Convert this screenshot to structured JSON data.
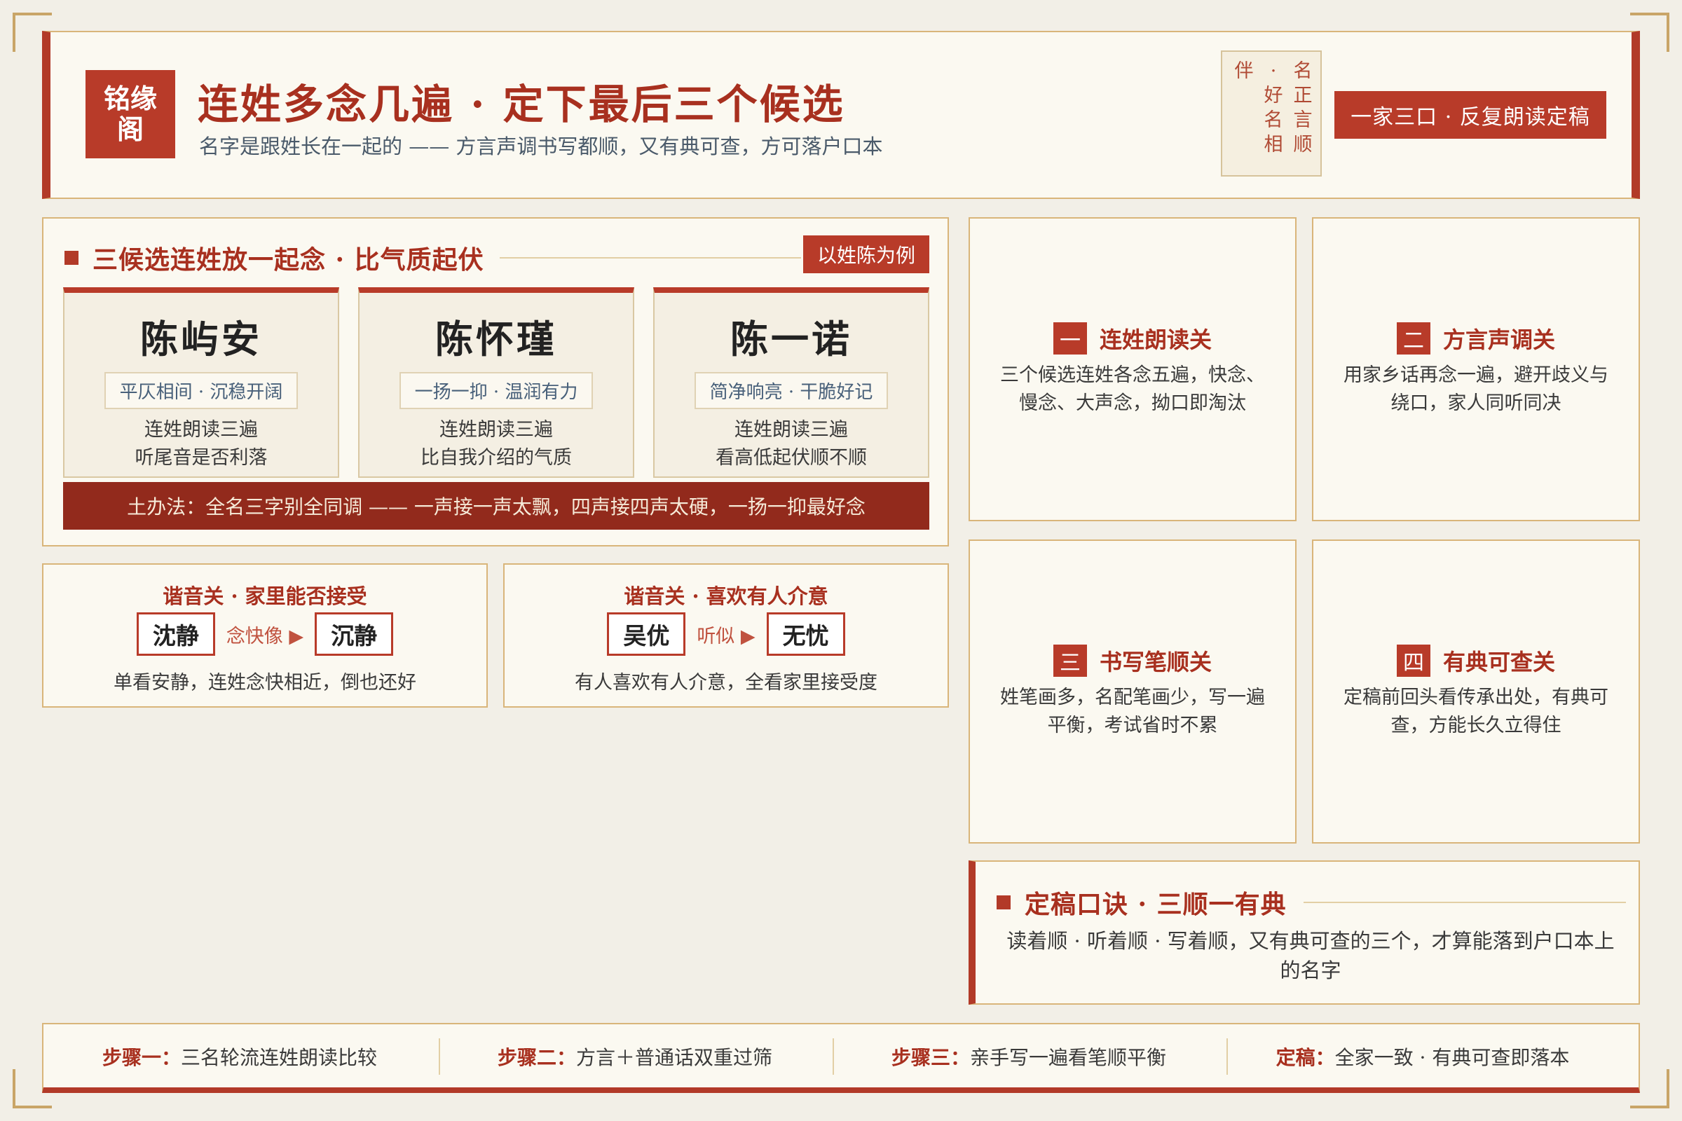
{
  "header": {
    "logo": "铭缘阁",
    "title": "连姓多念几遍 · 定下最后三个候选",
    "subtitle": "名字是跟姓长在一起的 —— 方言声调书写都顺，又有典可查，方可落户口本",
    "seal_cols": [
      "名正言顺",
      "·好名相",
      "伴"
    ],
    "tag": "一家三口 · 反复朗读定稿"
  },
  "candidates": {
    "title": "三候选连姓放一起念 · 比气质起伏",
    "tag": "以姓陈为例",
    "cards": [
      {
        "name": "陈屿安",
        "badge": "平仄相间 · 沉稳开阔",
        "line1": "连姓朗读三遍",
        "line2": "听尾音是否利落"
      },
      {
        "name": "陈怀瑾",
        "badge": "一扬一抑 · 温润有力",
        "line1": "连姓朗读三遍",
        "line2": "比自我介绍的气质"
      },
      {
        "name": "陈一诺",
        "badge": "简净响亮 · 干脆好记",
        "line1": "连姓朗读三遍",
        "line2": "看高低起伏顺不顺"
      }
    ],
    "tip": "土办法：全名三字别全同调 —— 一声接一声太飘，四声接四声太硬，一扬一抑最好念"
  },
  "homophones": [
    {
      "title": "谐音关 · 家里能否接受",
      "a": "沈静",
      "mid": "念快像",
      "b": "沉静",
      "desc": "单看安静，连姓念快相近，倒也还好"
    },
    {
      "title": "谐音关 · 喜欢有人介意",
      "a": "吴优",
      "mid": "听似",
      "b": "无忧",
      "desc": "有人喜欢有人介意，全看家里接受度"
    }
  ],
  "rules": [
    {
      "num": "一",
      "title": "连姓朗读关",
      "desc": "三个候选连姓各念五遍，快念、慢念、大声念，拗口即淘汰"
    },
    {
      "num": "二",
      "title": "方言声调关",
      "desc": "用家乡话再念一遍，避开歧义与绕口，家人同听同决"
    },
    {
      "num": "三",
      "title": "书写笔顺关",
      "desc": "姓笔画多，名配笔画少，写一遍平衡，考试省时不累"
    },
    {
      "num": "四",
      "title": "有典可查关",
      "desc": "定稿前回头看传承出处，有典可查，方能长久立得住"
    }
  ],
  "motto": {
    "title": "定稿口诀 · 三顺一有典",
    "desc": "读着顺 · 听着顺 · 写着顺，又有典可查的三个，才算能落到户口本上的名字"
  },
  "steps": [
    {
      "label": "步骤一：",
      "text": "三名轮流连姓朗读比较"
    },
    {
      "label": "步骤二：",
      "text": "方言＋普通话双重过筛"
    },
    {
      "label": "步骤三：",
      "text": "亲手写一遍看笔顺平衡"
    },
    {
      "label": "定稿：",
      "text": "全家一致 · 有典可查即落本"
    }
  ]
}
